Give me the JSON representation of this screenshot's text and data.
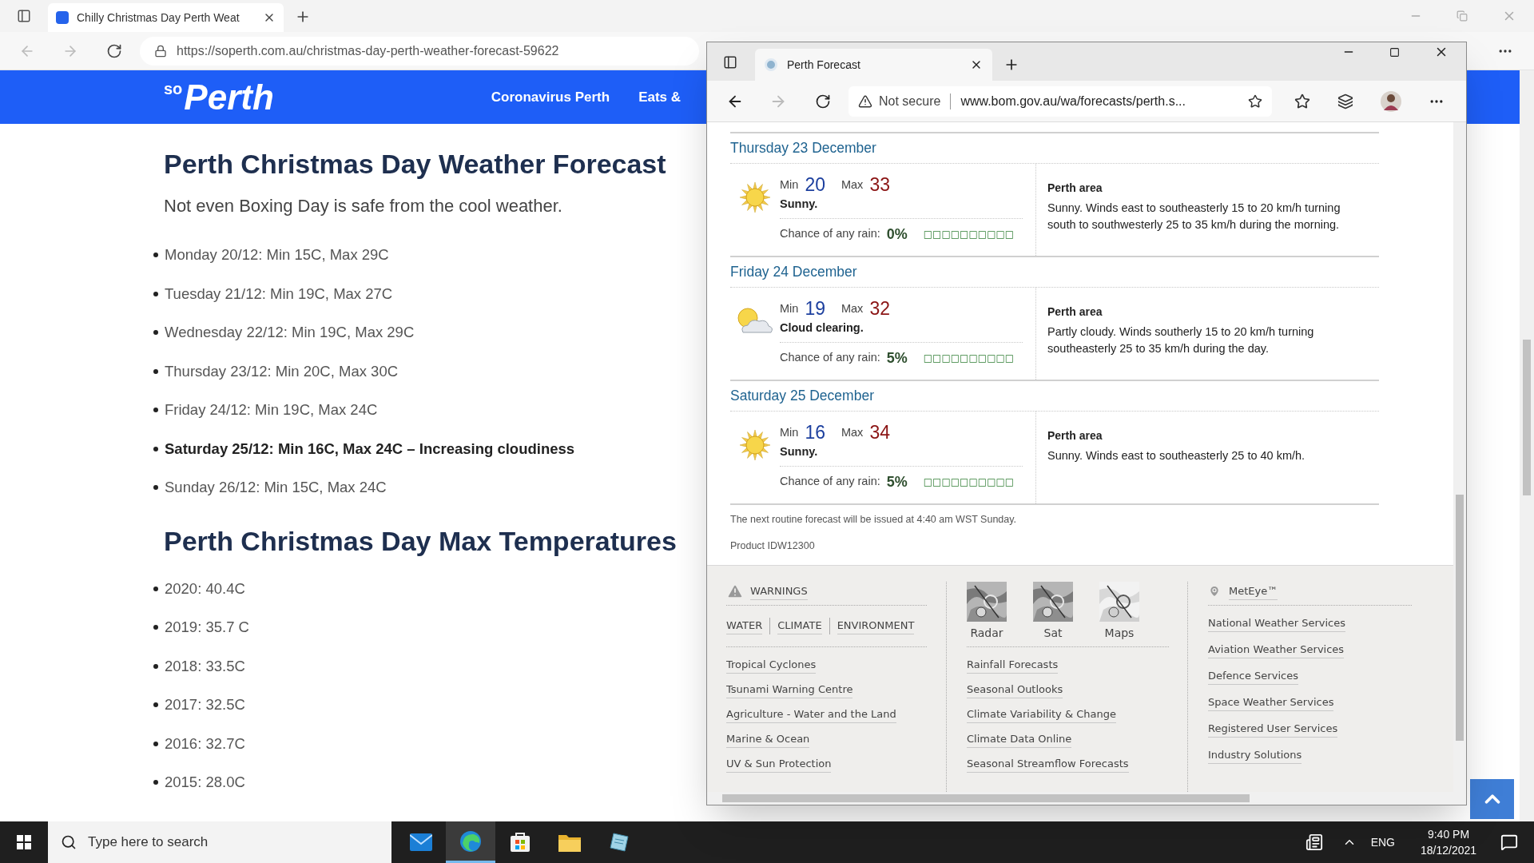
{
  "back_window": {
    "tab": {
      "title": "Chilly Christmas Day Perth Weat"
    },
    "address": "https://soperth.com.au/christmas-day-perth-weather-forecast-59622",
    "site": {
      "logo_prefix": "so",
      "logo": "Perth",
      "nav": [
        "Coronavirus Perth",
        "Eats &"
      ]
    },
    "article": {
      "heading": "Perth Christmas Day Weather Forecast",
      "subtitle": "Not even Boxing Day is safe from the cool weather.",
      "forecast": [
        {
          "text": "Monday 20/12: Min 15C, Max 29C",
          "bold": false
        },
        {
          "text": "Tuesday 21/12: Min 19C, Max 27C",
          "bold": false
        },
        {
          "text": "Wednesday 22/12: Min 19C, Max 29C",
          "bold": false
        },
        {
          "text": "Thursday 23/12: Min 20C, Max 30C",
          "bold": false
        },
        {
          "text": "Friday 24/12: Min 19C, Max 24C",
          "bold": false
        },
        {
          "text": "Saturday 25/12: Min 16C, Max 24C – Increasing cloudiness",
          "bold": true
        },
        {
          "text": "Sunday 26/12: Min 15C, Max 24C",
          "bold": false
        }
      ],
      "heading_2": "Perth Christmas Day Max Temperatures",
      "max_temps": [
        "2020: 40.4C",
        "2019: 35.7 C",
        "2018: 33.5C",
        "2017: 32.5C",
        "2016: 32.7C",
        "2015: 28.0C"
      ]
    }
  },
  "front_window": {
    "tab": {
      "title": "Perth Forecast"
    },
    "security": "Not secure",
    "address": "www.bom.gov.au/wa/forecasts/perth.s...",
    "days": [
      {
        "date": "Thursday 23 December",
        "kind": "sunny",
        "min_label": "Min",
        "max_label": "Max",
        "rain_label": "Chance of any rain:",
        "min": "20",
        "max": "33",
        "summary": "Sunny.",
        "rain": "0%",
        "rain_boxes": "□□□□□□□□□□",
        "area": "Perth area",
        "details": "Sunny. Winds east to southeasterly 15 to 20 km/h turning south to southwesterly 25 to 35 km/h during the morning."
      },
      {
        "date": "Friday 24 December",
        "kind": "partly_cloudy",
        "min_label": "Min",
        "max_label": "Max",
        "rain_label": "Chance of any rain:",
        "min": "19",
        "max": "32",
        "summary": "Cloud clearing.",
        "rain": "5%",
        "rain_boxes": "□□□□□□□□□□",
        "area": "Perth area",
        "details": "Partly cloudy. Winds southerly 15 to 20 km/h turning southeasterly 25 to 35 km/h during the day."
      },
      {
        "date": "Saturday 25 December",
        "kind": "sunny",
        "min_label": "Min",
        "max_label": "Max",
        "rain_label": "Chance of any rain:",
        "min": "16",
        "max": "34",
        "summary": "Sunny.",
        "rain": "5%",
        "rain_boxes": "□□□□□□□□□□",
        "area": "Perth area",
        "details": "Sunny. Winds east to southeasterly 25 to 40 km/h."
      }
    ],
    "notice": "The next routine forecast will be issued at 4:40 am WST Sunday.",
    "product": "Product IDW12300",
    "footer": {
      "warnings": "WARNINGS",
      "sections": [
        "WATER",
        "CLIMATE",
        "ENVIRONMENT"
      ],
      "links_1": [
        "Tropical Cyclones",
        "Tsunami Warning Centre",
        "Agriculture - Water and the Land",
        "Marine & Ocean",
        "UV & Sun Protection"
      ],
      "thumbs": [
        "Radar",
        "Sat",
        "Maps"
      ],
      "links_2": [
        "Rainfall Forecasts",
        "Seasonal Outlooks",
        "Climate Variability & Change",
        "Climate Data Online",
        "Seasonal Streamflow Forecasts"
      ],
      "meteye": "MetEye™",
      "links_3": [
        "National Weather Services",
        "Aviation Weather Services",
        "Defence Services",
        "Space Weather Services",
        "Registered User Services",
        "Industry Solutions"
      ]
    }
  },
  "taskbar": {
    "search_placeholder": "Type here to search",
    "apps": [
      {
        "kind": "mail",
        "selected": false
      },
      {
        "kind": "browser",
        "selected": true
      },
      {
        "kind": "store",
        "selected": false
      },
      {
        "kind": "folder",
        "selected": false
      },
      {
        "kind": "app",
        "selected": false
      }
    ],
    "language": "ENG",
    "time": "9:40 PM",
    "date": "18/12/2021"
  }
}
